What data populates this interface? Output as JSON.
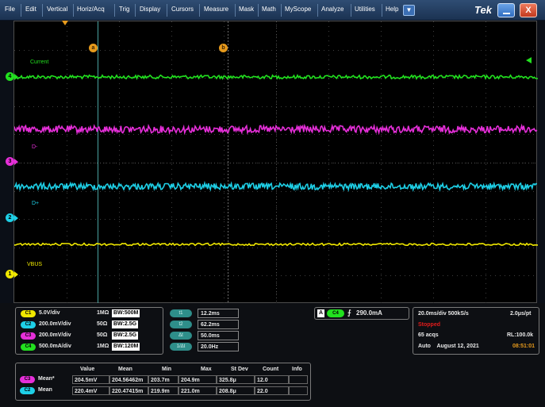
{
  "menu": [
    "File",
    "Edit",
    "Vertical",
    "Horiz/Acq",
    "Trig",
    "Display",
    "Cursors",
    "Measure",
    "Mask",
    "Math",
    "MyScope",
    "Analyze",
    "Utilities",
    "Help"
  ],
  "brand": "Tek",
  "close_label": "X",
  "dropdown_glyph": "▼",
  "cursor_labels": {
    "a": "a",
    "b": "b"
  },
  "waveform_labels": {
    "c4": "Current",
    "c3": "D-",
    "c2": "D+",
    "c1": "VBUS"
  },
  "channel_markers": {
    "c4": "4",
    "c3": "3",
    "c2": "2",
    "c1": "1"
  },
  "colors": {
    "c1": "#f0e800",
    "c2": "#1ecfe6",
    "c3": "#e62fd9",
    "c4": "#22e11f",
    "cursor": "#e69a1c"
  },
  "channels": [
    {
      "badge": "C1",
      "scale": "5.0V/div",
      "impedance": "1MΩ",
      "bw": "BW:500M"
    },
    {
      "badge": "C2",
      "scale": "200.0mV/div",
      "impedance": "50Ω",
      "bw": "BW:2.5G"
    },
    {
      "badge": "C3",
      "scale": "200.0mV/div",
      "impedance": "50Ω",
      "bw": "BW:2.5G"
    },
    {
      "badge": "C4",
      "scale": "500.0mA/div",
      "impedance": "1MΩ",
      "bw": "BW:120M"
    }
  ],
  "cursors": [
    {
      "label": "t1",
      "value": "12.2ms"
    },
    {
      "label": "t2",
      "value": "62.2ms"
    },
    {
      "label": "Δt",
      "value": "50.0ms"
    },
    {
      "label": "1/Δt",
      "value": "20.0Hz"
    }
  ],
  "trigger": {
    "mode": "A",
    "source": "C4",
    "slope": "⨍",
    "level": "290.0mA"
  },
  "timebase": {
    "scale_rate": "20.0ms/div 500kS/s",
    "per_pt": "2.0μs/pt",
    "status": "Stopped",
    "acqs": "65 acqs",
    "record": "RL:100.0k",
    "mode_date": "Auto    August 12, 2021",
    "time": "08:51:01"
  },
  "measurements": {
    "headers": [
      "Value",
      "Mean",
      "Min",
      "Max",
      "St Dev",
      "Count",
      "Info"
    ],
    "rows": [
      {
        "badge": "C3",
        "name": "Mean*",
        "value": "204.5mV",
        "mean": "204.56462m",
        "min": "203.7m",
        "max": "204.9m",
        "stdev": "325.8μ",
        "count": "12.0",
        "info": ""
      },
      {
        "badge": "C2",
        "name": "Mean",
        "value": "220.4mV",
        "mean": "220.47415m",
        "min": "219.9m",
        "max": "221.0m",
        "stdev": "208.8μ",
        "count": "22.0",
        "info": ""
      }
    ]
  }
}
